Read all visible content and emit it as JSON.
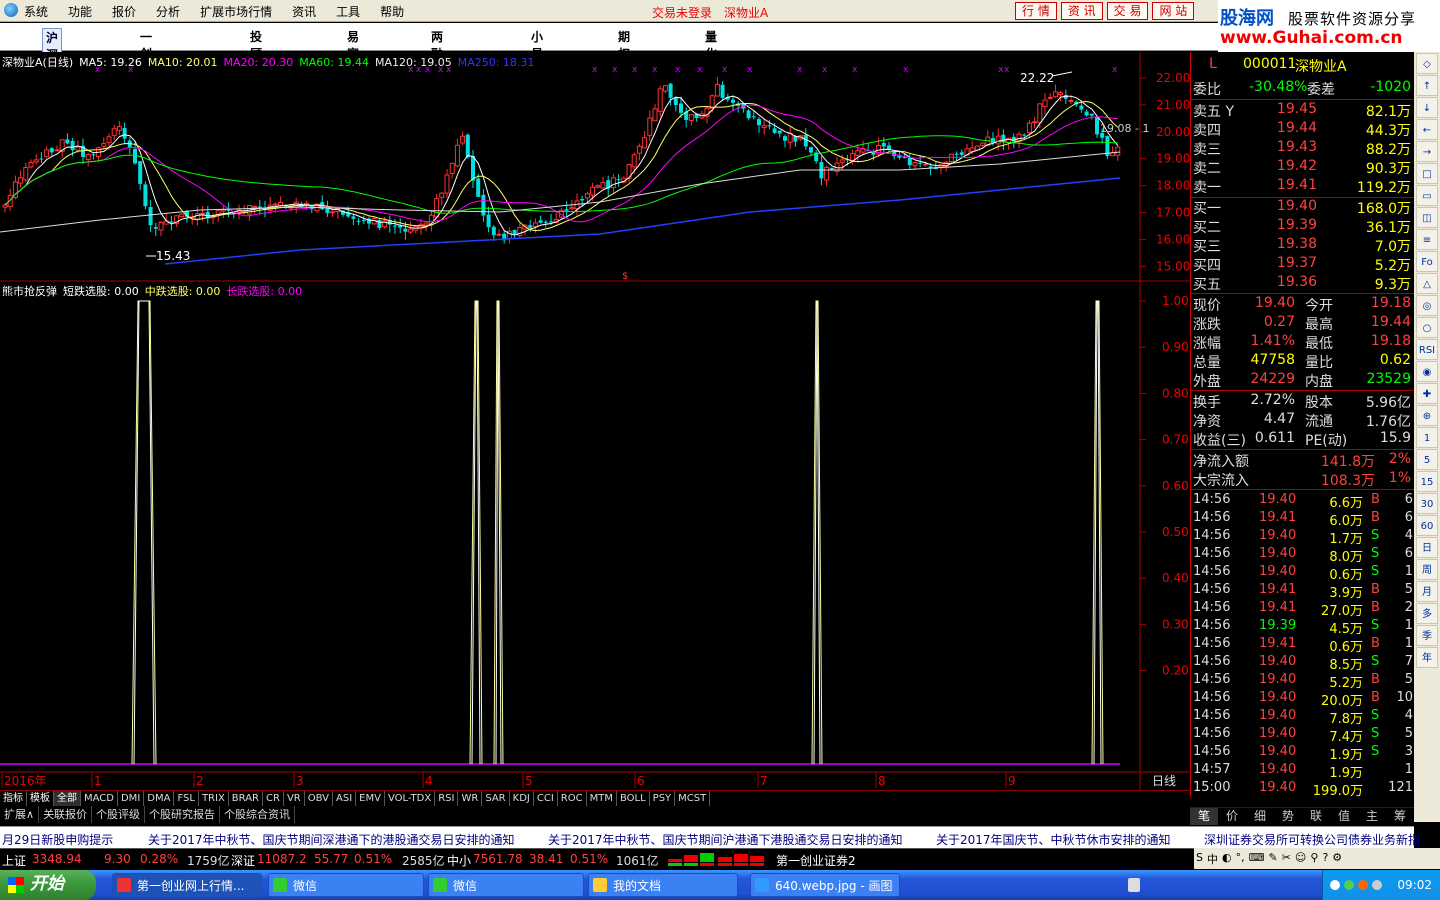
{
  "menubar": {
    "items": [
      "系统",
      "功能",
      "报价",
      "分析",
      "扩展市场行情",
      "资讯",
      "工具",
      "帮助"
    ],
    "login_status": "交易未登录",
    "stock_name": "深物业A"
  },
  "top_tabs": [
    "行 情",
    "资 讯",
    "交 易",
    "网 站"
  ],
  "logo": {
    "brand": "股海网",
    "slogan": "股票软件资源分享",
    "url": "www.Guhai.com.cn"
  },
  "navbar": [
    "沪深行情",
    "一创直播间",
    "投顾产品",
    "易富汇",
    "两融券源",
    "小易融",
    "期权汇",
    "量化汇"
  ],
  "kline": {
    "legend": [
      {
        "text": "深物业A(日线)",
        "color": "#ffffff"
      },
      {
        "text": "MA5: 19.26",
        "color": "#ffffff"
      },
      {
        "text": "MA10: 20.01",
        "color": "#ffff66"
      },
      {
        "text": "MA20: 20.30",
        "color": "#ff00ff"
      },
      {
        "text": "MA60: 19.44",
        "color": "#00ff00"
      },
      {
        "text": "MA120: 19.05",
        "color": "#eeeeee"
      },
      {
        "text": "MA250: 18.31",
        "color": "#3333ff"
      }
    ],
    "y_labels": [
      "22.00",
      "21.00",
      "20.00",
      "19.00",
      "18.00",
      "17.00",
      "16.00",
      "15.00"
    ],
    "high_label": "22.22",
    "low_label": "15.43",
    "last_label": "19.08 - 1"
  },
  "indicator": {
    "legend": [
      {
        "text": "熊市抢反弹",
        "color": "#ffffff"
      },
      {
        "text": "短跌选股: 0.00",
        "color": "#ffffff"
      },
      {
        "text": "中跌选股: 0.00",
        "color": "#ffff66"
      },
      {
        "text": "长跌选股: 0.00",
        "color": "#ff00ff"
      }
    ],
    "y_labels": [
      "1.00",
      "0.90",
      "0.80",
      "0.70",
      "0.60",
      "0.50",
      "0.40",
      "0.30",
      "0.20"
    ],
    "spikes": [
      {
        "pos": "jan"
      },
      {
        "pos": "apr"
      },
      {
        "pos": "apr2"
      },
      {
        "pos": "jul"
      },
      {
        "pos": "sep"
      }
    ]
  },
  "xaxis": {
    "labels": [
      "2016年",
      "1",
      "2",
      "3",
      "4",
      "5",
      "6",
      "7",
      "8",
      "9"
    ],
    "period": "日线"
  },
  "chart_toolbar": [
    "+",
    "-",
    "0"
  ],
  "quote": {
    "code": "000011",
    "name": "深物业A",
    "mark": "L",
    "wb_label": "委比",
    "wb_value": "-30.48%",
    "wc_label": "委差",
    "wc_value": "-1020",
    "asks": [
      {
        "label": "卖五 Y",
        "price": "19.45",
        "vol": "82.1万"
      },
      {
        "label": "卖四",
        "price": "19.44",
        "vol": "44.3万"
      },
      {
        "label": "卖三",
        "price": "19.43",
        "vol": "88.2万"
      },
      {
        "label": "卖二",
        "price": "19.42",
        "vol": "90.3万"
      },
      {
        "label": "卖一",
        "price": "19.41",
        "vol": "119.2万"
      }
    ],
    "bids": [
      {
        "label": "买一",
        "price": "19.40",
        "vol": "168.0万"
      },
      {
        "label": "买二",
        "price": "19.39",
        "vol": "36.1万"
      },
      {
        "label": "买三",
        "price": "19.38",
        "vol": "7.0万"
      },
      {
        "label": "买四",
        "price": "19.37",
        "vol": "5.2万"
      },
      {
        "label": "买五",
        "price": "19.36",
        "vol": "9.3万"
      }
    ],
    "stats": [
      {
        "l1": "现价",
        "v1": "19.40",
        "c1": "#ff4040",
        "l2": "今开",
        "v2": "19.18",
        "c2": "#ff4040"
      },
      {
        "l1": "涨跌",
        "v1": "0.27",
        "c1": "#ff4040",
        "l2": "最高",
        "v2": "19.44",
        "c2": "#ff4040"
      },
      {
        "l1": "涨幅",
        "v1": "1.41%",
        "c1": "#ff4040",
        "l2": "最低",
        "v2": "19.18",
        "c2": "#ff4040"
      },
      {
        "l1": "总量",
        "v1": "47758",
        "c1": "#ffff00",
        "l2": "量比",
        "v2": "0.62",
        "c2": "#ffff00"
      },
      {
        "l1": "外盘",
        "v1": "24229",
        "c1": "#ff4040",
        "l2": "内盘",
        "v2": "23529",
        "c2": "#00ff00"
      }
    ],
    "stats2": [
      {
        "l1": "换手",
        "v1": "2.72%",
        "l2": "股本",
        "v2": "5.96亿"
      },
      {
        "l1": "净资",
        "v1": "4.47",
        "l2": "流通",
        "v2": "1.76亿"
      },
      {
        "l1": "收益(三)",
        "v1": "0.611",
        "l2": "PE(动)",
        "v2": "15.9"
      }
    ],
    "flows": [
      {
        "label": "净流入额",
        "value": "141.8万",
        "pct": "2%"
      },
      {
        "label": "大宗流入",
        "value": "108.3万",
        "pct": "1%"
      }
    ],
    "ticks": [
      {
        "t": "14:56",
        "p": "19.40",
        "v": "6.6万",
        "d": "B",
        "n": "6"
      },
      {
        "t": "14:56",
        "p": "19.41",
        "v": "6.0万",
        "d": "B",
        "n": "6"
      },
      {
        "t": "14:56",
        "p": "19.40",
        "v": "1.7万",
        "d": "S",
        "n": "4"
      },
      {
        "t": "14:56",
        "p": "19.40",
        "v": "8.0万",
        "d": "S",
        "n": "6"
      },
      {
        "t": "14:56",
        "p": "19.40",
        "v": "0.6万",
        "d": "S",
        "n": "1"
      },
      {
        "t": "14:56",
        "p": "19.41",
        "v": "3.9万",
        "d": "B",
        "n": "5"
      },
      {
        "t": "14:56",
        "p": "19.41",
        "v": "27.0万",
        "d": "B",
        "n": "2"
      },
      {
        "t": "14:56",
        "p": "19.39",
        "v": "4.5万",
        "d": "S",
        "n": "1"
      },
      {
        "t": "14:56",
        "p": "19.41",
        "v": "0.6万",
        "d": "B",
        "n": "1"
      },
      {
        "t": "14:56",
        "p": "19.40",
        "v": "8.5万",
        "d": "S",
        "n": "7"
      },
      {
        "t": "14:56",
        "p": "19.40",
        "v": "5.2万",
        "d": "B",
        "n": "5"
      },
      {
        "t": "14:56",
        "p": "19.40",
        "v": "20.0万",
        "d": "B",
        "n": "10"
      },
      {
        "t": "14:56",
        "p": "19.40",
        "v": "7.8万",
        "d": "S",
        "n": "4"
      },
      {
        "t": "14:56",
        "p": "19.40",
        "v": "7.4万",
        "d": "S",
        "n": "5"
      },
      {
        "t": "14:56",
        "p": "19.40",
        "v": "1.9万",
        "d": "S",
        "n": "3"
      },
      {
        "t": "14:57",
        "p": "19.40",
        "v": "1.9万",
        "d": "",
        "n": "1"
      },
      {
        "t": "15:00",
        "p": "19.40",
        "v": "199.0万",
        "d": "",
        "n": "121"
      }
    ]
  },
  "side_toolbar": [
    "◇",
    "↑",
    "↓",
    "←",
    "→",
    "□",
    "▭",
    "◫",
    "≡",
    "Fo",
    "△",
    "◎",
    "○",
    "RSI",
    "◉",
    "✚",
    "⊕",
    "1",
    "5",
    "15",
    "30",
    "60",
    "日",
    "周",
    "月",
    "多",
    "季",
    "年"
  ],
  "indicator_tabs": [
    "指标",
    "模板",
    "全部",
    "MACD",
    "DMI",
    "DMA",
    "FSL",
    "TRIX",
    "BRAR",
    "CR",
    "VR",
    "OBV",
    "ASI",
    "EMV",
    "VOL-TDX",
    "RSI",
    "WR",
    "SAR",
    "KDJ",
    "CCI",
    "ROC",
    "MTM",
    "BOLL",
    "PSY",
    "MCST"
  ],
  "info_tabs": [
    "扩展∧",
    "关联报价",
    "个股评级",
    "个股研究报告",
    "个股综合资讯"
  ],
  "rp_tabs": [
    "笔",
    "价",
    "细",
    "势",
    "联",
    "值",
    "主",
    "筹"
  ],
  "ticker": [
    "月29日新股申购提示",
    "关于2017年中秋节、国庆节期间深港通下的港股通交易日安排的通知",
    "关于2017年中秋节、国庆节期间沪港通下港股通交易日安排的通知",
    "关于2017年国庆节、中秋节休市安排的通知",
    "深圳证券交易所可转换公司债券业务新指"
  ],
  "index_bar": {
    "sh_label": "上证",
    "sh_value": "3348.94",
    "sh_chg": "9.30",
    "sh_pct": "0.28%",
    "sh_amt": "1759亿",
    "sz_label": "深证",
    "sz_value": "11087.2",
    "sz_chg": "55.77",
    "sz_pct": "0.51%",
    "sz_amt": "2585亿",
    "zx_label": "中小",
    "zx_value": "7561.78",
    "zx_chg": "38.41",
    "zx_pct": "0.51%",
    "zx_amt": "1061亿",
    "broker": "第一创业证券2"
  },
  "ime_bar": [
    "S",
    "中",
    "◐",
    "°,",
    "⌨",
    "✎",
    "✂",
    "☺",
    "⚲",
    "?",
    "⚙"
  ],
  "taskbar": {
    "start": "开始",
    "tasks": [
      "第一创业网上行情...",
      "微信",
      "微信",
      "我的文档",
      "640.webp.jpg - 画图"
    ],
    "clock": "09:02"
  }
}
